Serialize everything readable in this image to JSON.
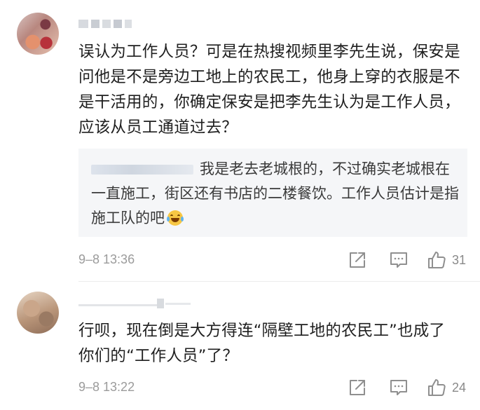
{
  "comments": [
    {
      "text": "误认为工作人员？可是在热搜视频里李先生说，保安是问他是不是旁边工地上的农民工，他身上穿的衣服是不是干活用的，你确定保安是把李先生认为是工作人员，应该从员工通道过去？",
      "reply": {
        "text": "我是老去老城根的，不过确实老城根在一直施工，街区还有书店的二楼餐饮。工作人员估计是指施工队的吧"
      },
      "timestamp": "9–8 13:36",
      "like_count": "31"
    },
    {
      "text": "行呗，现在倒是大方得连“隔壁工地的农民工”也成了你们的“工作人员”了？",
      "timestamp": "9–8 13:22",
      "like_count": "24"
    }
  ],
  "icons": {
    "share": "share-icon",
    "comment": "comment-icon",
    "like": "thumbs-up-icon",
    "emoji": "tears-of-joy-emoji-icon"
  },
  "colors": {
    "text_primary": "#1f1f1f",
    "text_meta": "#9b9b9b",
    "reply_background": "#f5f6f8"
  }
}
